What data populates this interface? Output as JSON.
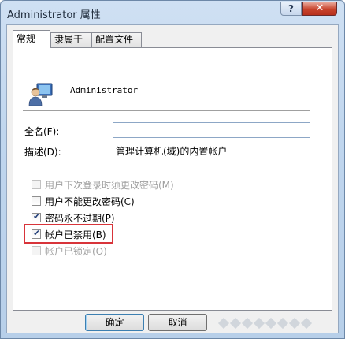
{
  "window": {
    "title": "Administrator 属性",
    "help_glyph": "?",
    "close_glyph": "✕"
  },
  "tabs": [
    {
      "label": "常规",
      "active": true
    },
    {
      "label": "隶属于",
      "active": false
    },
    {
      "label": "配置文件",
      "active": false
    }
  ],
  "general": {
    "username": "Administrator",
    "fullname": {
      "label": "全名(F):",
      "value": ""
    },
    "description": {
      "label": "描述(D):",
      "value": "管理计算机(域)的内置帐户"
    },
    "checkboxes": [
      {
        "label": "用户下次登录时须更改密码(M)",
        "checked": false,
        "enabled": false
      },
      {
        "label": "用户不能更改密码(C)",
        "checked": false,
        "enabled": true
      },
      {
        "label": "密码永不过期(P)",
        "checked": true,
        "enabled": true
      },
      {
        "label": "帐户已禁用(B)",
        "checked": true,
        "enabled": true
      },
      {
        "label": "帐户已锁定(O)",
        "checked": false,
        "enabled": false
      }
    ]
  },
  "buttons": {
    "ok": "确定",
    "cancel": "取消"
  },
  "icons": {
    "user": "user-icon",
    "help": "help-icon",
    "close": "close-icon"
  },
  "colors": {
    "highlight": "#d8343a",
    "title_bar": "#c0d6ee"
  }
}
